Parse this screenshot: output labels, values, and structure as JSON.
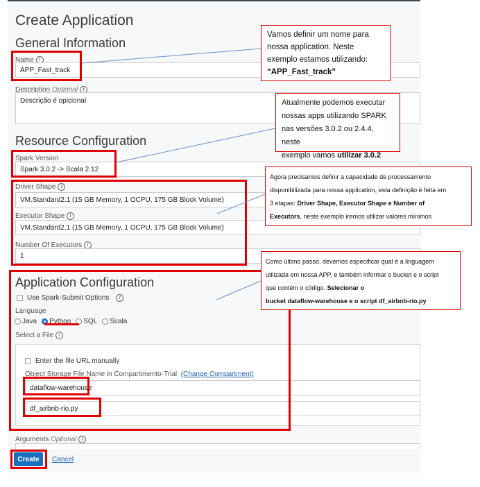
{
  "page": {
    "title": "Create Application"
  },
  "general": {
    "heading": "General Information",
    "name_label": "Name",
    "name_value": "APP_Fast_track",
    "description_label": "Description",
    "optional_label": "Optional",
    "description_value": "Descrição é opicional"
  },
  "resource": {
    "heading": "Resource Configuration",
    "spark_version_label": "Spark Version",
    "spark_version_value": "Spark 3.0.2 -> Scala 2.12",
    "driver_shape_label": "Driver Shape",
    "driver_shape_value": "VM.Standard2.1 (15 GB Memory, 1 OCPU, 175 GB Block Volume)",
    "executor_shape_label": "Executor Shape",
    "executor_shape_value": "VM.Standard2.1 (15 GB Memory, 1 OCPU, 175 GB Block Volume)",
    "executors_label": "Number Of Executors",
    "executors_value": "1"
  },
  "application": {
    "heading": "Application Configuration",
    "spark_submit_label": "Use Spark-Submit Options",
    "language_label": "Language",
    "languages": [
      "Java",
      "Python",
      "SQL",
      "Scala"
    ],
    "selected_language": "Python",
    "select_file_label": "Select a File",
    "enter_url_label": "Enter the file URL manually",
    "storage_label": "Object Storage File Name in Compartimento-Trial",
    "change_compartment": "(Change Compartment)",
    "bucket_value": "dataflow-warehouse",
    "file_value": "df_airbnb-rio.py",
    "arguments_label": "Arguments",
    "optional_label": "Optional"
  },
  "actions": {
    "create": "Create",
    "cancel": "Cancel"
  },
  "notes": {
    "n1_line1": "Vamos definir um nome para",
    "n1_line2": "nossa application. Neste",
    "n1_line3": "exemplo estamos utilizando:",
    "n1_bold": "“APP_Fast_track”",
    "n2_line1": "Atualmente podemos executar",
    "n2_line2": "nossas apps utilizando SPARK",
    "n2_line3": "nas versões 3.0.2 ou 2.4.4, neste",
    "n2_line4a": "exemplo vamos ",
    "n2_bold": "utilizar 3.0.2",
    "n3_line1": "Agora precisamos definir a capacidade de processamento",
    "n3_line2": "disponibilizada para nossa application, esta definição é feita em",
    "n3_line3a": "3 etapas: ",
    "n3_bold1": "Driver Shape, Executor Shape e Number of",
    "n3_bold2": "Executors",
    "n3_line4b": ", neste exemplo iremos utilizar valores mínimos",
    "n4_line1": "Como último passo, devemos especificar qual é a linguagem",
    "n4_line2": "utilizada em nossa APP, e também informar o bucket e o script",
    "n4_line3a": "que contém o código. ",
    "n4_bold1": "Selecionar o",
    "n4_bold2": "bucket dataflow-warehouse e o script df_airbnb-rio.py"
  },
  "colors": {
    "annotation_red": "#e00000",
    "primary_button": "#1a6fc1",
    "link": "#1a5fb4"
  }
}
